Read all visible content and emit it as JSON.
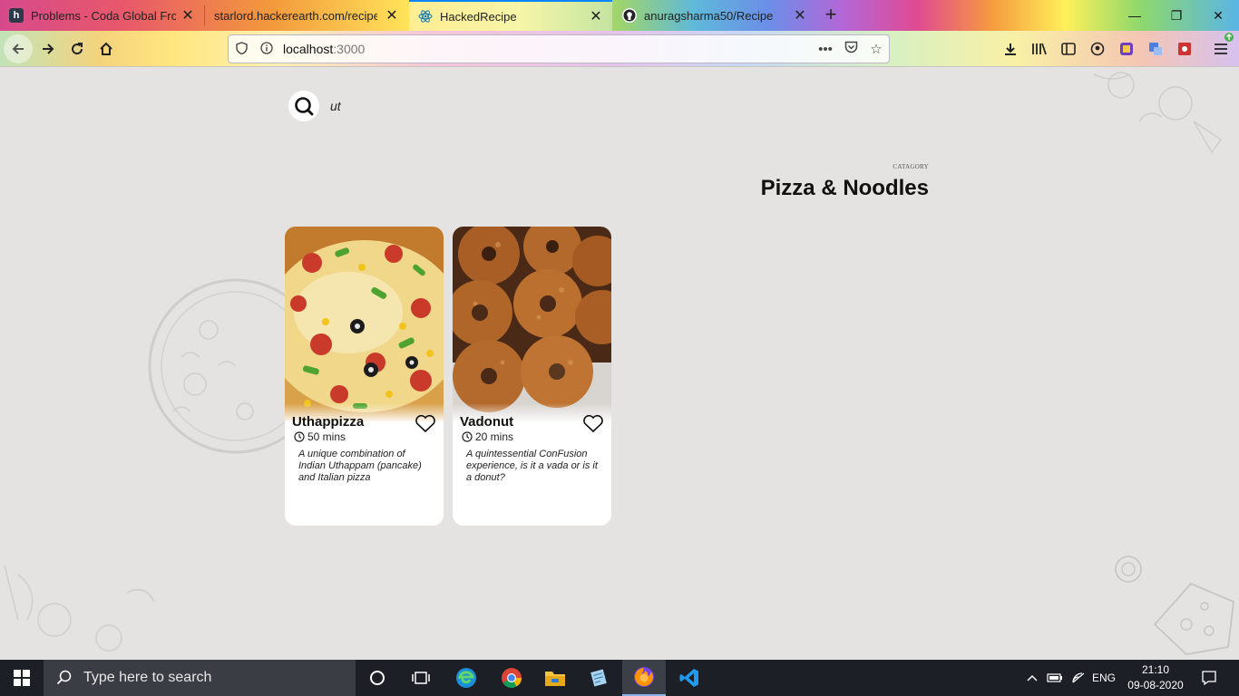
{
  "browser": {
    "tabs": [
      {
        "title": "Problems - Coda Global Front",
        "favicon": "hackerearth-icon",
        "active": false
      },
      {
        "title": "starlord.hackerearth.com/recipe",
        "favicon": "none",
        "active": false
      },
      {
        "title": "HackedRecipe",
        "favicon": "react-icon",
        "active": true
      },
      {
        "title": "anuragsharma50/Recipe",
        "favicon": "github-icon",
        "active": false
      }
    ],
    "url_host": "localhost",
    "url_port": ":3000"
  },
  "search": {
    "value": "ut"
  },
  "category": {
    "label": "CATAGORY",
    "title": "Pizza & Noodles"
  },
  "recipes": [
    {
      "name": "Uthappizza",
      "time": "50 mins",
      "description": "A unique combination of Indian Uthappam (pancake) and Italian pizza",
      "image": "pizza-photo"
    },
    {
      "name": "Vadonut",
      "time": "20 mins",
      "description": "A quintessential ConFusion experience, is it a vada or is it a donut?",
      "image": "donut-photo"
    }
  ],
  "taskbar": {
    "search_placeholder": "Type here to search",
    "language": "ENG",
    "time": "21:10",
    "date": "09-08-2020"
  },
  "colors": {
    "page_background": "#e4e3e1",
    "card_background": "#ffffff",
    "taskbar": "#1c1f26"
  }
}
